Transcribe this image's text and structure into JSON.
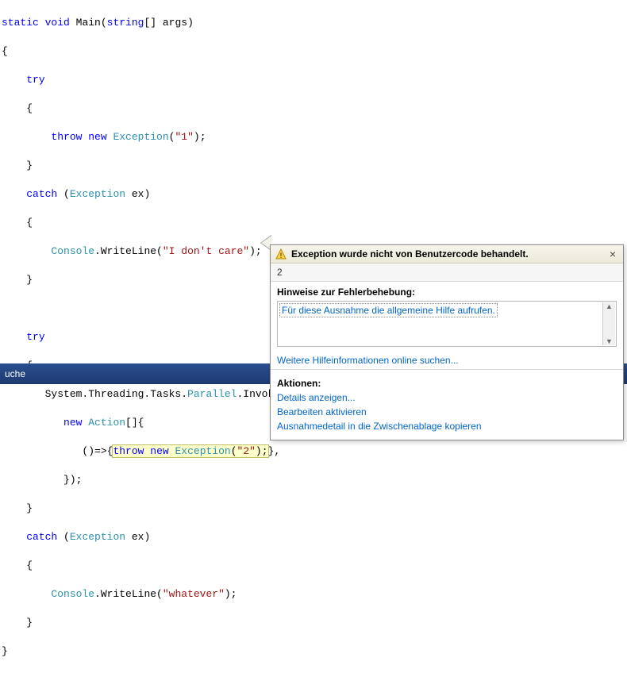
{
  "code": {
    "l1": "static void Main(string[] args)",
    "l1_kw1": "static",
    "l1_kw2": "void",
    "l1_id": " Main(",
    "l1_kw3": "string",
    "l1_rest": "[] args)",
    "l2": "{",
    "l3_indent": "    ",
    "l3_kw": "try",
    "l4": "    {",
    "l5_indent": "        ",
    "l5_kw1": "throw",
    "l5_kw2": " new ",
    "l5_type": "Exception",
    "l5_paren": "(",
    "l5_str": "\"1\"",
    "l5_end": ");",
    "l6": "    }",
    "l7_indent": "    ",
    "l7_kw": "catch",
    "l7_paren": " (",
    "l7_type": "Exception",
    "l7_rest": " ex)",
    "l8": "    {",
    "l9_indent": "        ",
    "l9_type": "Console",
    "l9_mid": ".WriteLine(",
    "l9_str": "\"I don't care\"",
    "l9_end": ");",
    "l10": "    }",
    "l11": "",
    "l12_indent": "    ",
    "l12_kw": "try",
    "l13": "    {",
    "l14_indent": "       ",
    "l14_p1": "System.Threading.Tasks.",
    "l14_type": "Parallel",
    "l14_p2": ".Invoke(",
    "l15_indent": "          ",
    "l15_kw": "new",
    "l15_sp": " ",
    "l15_type": "Action",
    "l15_rest": "[]{",
    "l16_indent": "             ",
    "l16_p1": "()=>{",
    "l16_kw1": "throw",
    "l16_sp": " ",
    "l16_kw2": "new",
    "l16_sp2": " ",
    "l16_type": "Exception",
    "l16_paren": "(",
    "l16_str": "\"2\"",
    "l16_end": ");",
    "l16_after": "},",
    "l17": "          });",
    "l18": "    }",
    "l19_indent": "    ",
    "l19_kw": "catch",
    "l19_paren": " (",
    "l19_type": "Exception",
    "l19_rest": " ex)",
    "l20": "    {",
    "l21_indent": "        ",
    "l21_type": "Console",
    "l21_mid": ".WriteLine(",
    "l21_str": "\"whatever\"",
    "l21_end": ");",
    "l22": "    }",
    "l23": "}"
  },
  "status": {
    "text": "uche"
  },
  "popup": {
    "title": "Exception wurde nicht von Benutzercode behandelt.",
    "value": "2",
    "hintsLabel": "Hinweise zur Fehlerbehebung:",
    "hintLink": "Für diese Ausnahme die allgemeine Hilfe aufrufen.",
    "moreHelp": "Weitere Hilfeinformationen online suchen...",
    "actionsLabel": "Aktionen:",
    "actionDetails": "Details anzeigen...",
    "actionEdit": "Bearbeiten aktivieren",
    "actionCopy": "Ausnahmedetail in die Zwischenablage kopieren"
  }
}
